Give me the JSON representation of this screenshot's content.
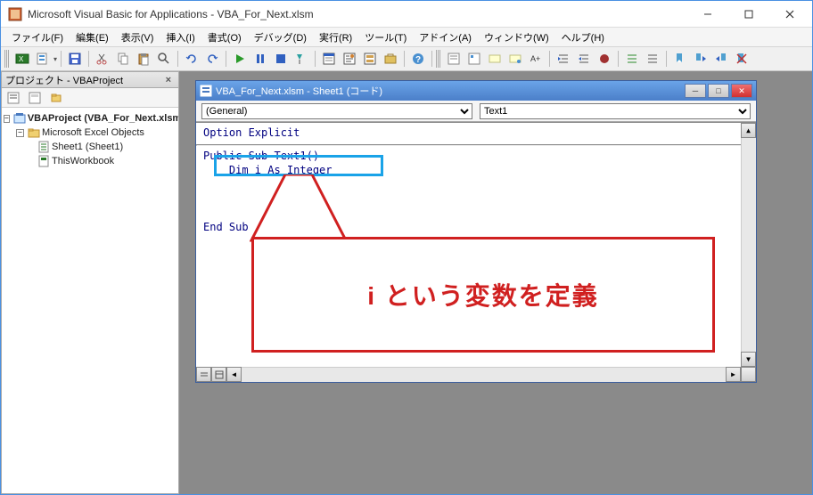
{
  "window": {
    "title": "Microsoft Visual Basic for Applications - VBA_For_Next.xlsm"
  },
  "menus": {
    "file": "ファイル(F)",
    "edit": "編集(E)",
    "view": "表示(V)",
    "insert": "挿入(I)",
    "format": "書式(O)",
    "debug": "デバッグ(D)",
    "run": "実行(R)",
    "tool": "ツール(T)",
    "addin": "アドイン(A)",
    "window": "ウィンドウ(W)",
    "help": "ヘルプ(H)"
  },
  "project_panel": {
    "title": "プロジェクト - VBAProject",
    "nodes": {
      "root": "VBAProject (VBA_For_Next.xlsm)",
      "objects": "Microsoft Excel Objects",
      "sheet1": "Sheet1 (Sheet1)",
      "workbook": "ThisWorkbook"
    }
  },
  "code_window": {
    "title": "VBA_For_Next.xlsm - Sheet1 (コード)",
    "selector_left": "(General)",
    "selector_right": "Text1",
    "lines": {
      "l1": "Option Explicit",
      "l2": "Public Sub Text1()",
      "l3": "    Dim i As Integer",
      "l4": "End Sub"
    }
  },
  "callout": {
    "text": "i という変数を定義"
  }
}
